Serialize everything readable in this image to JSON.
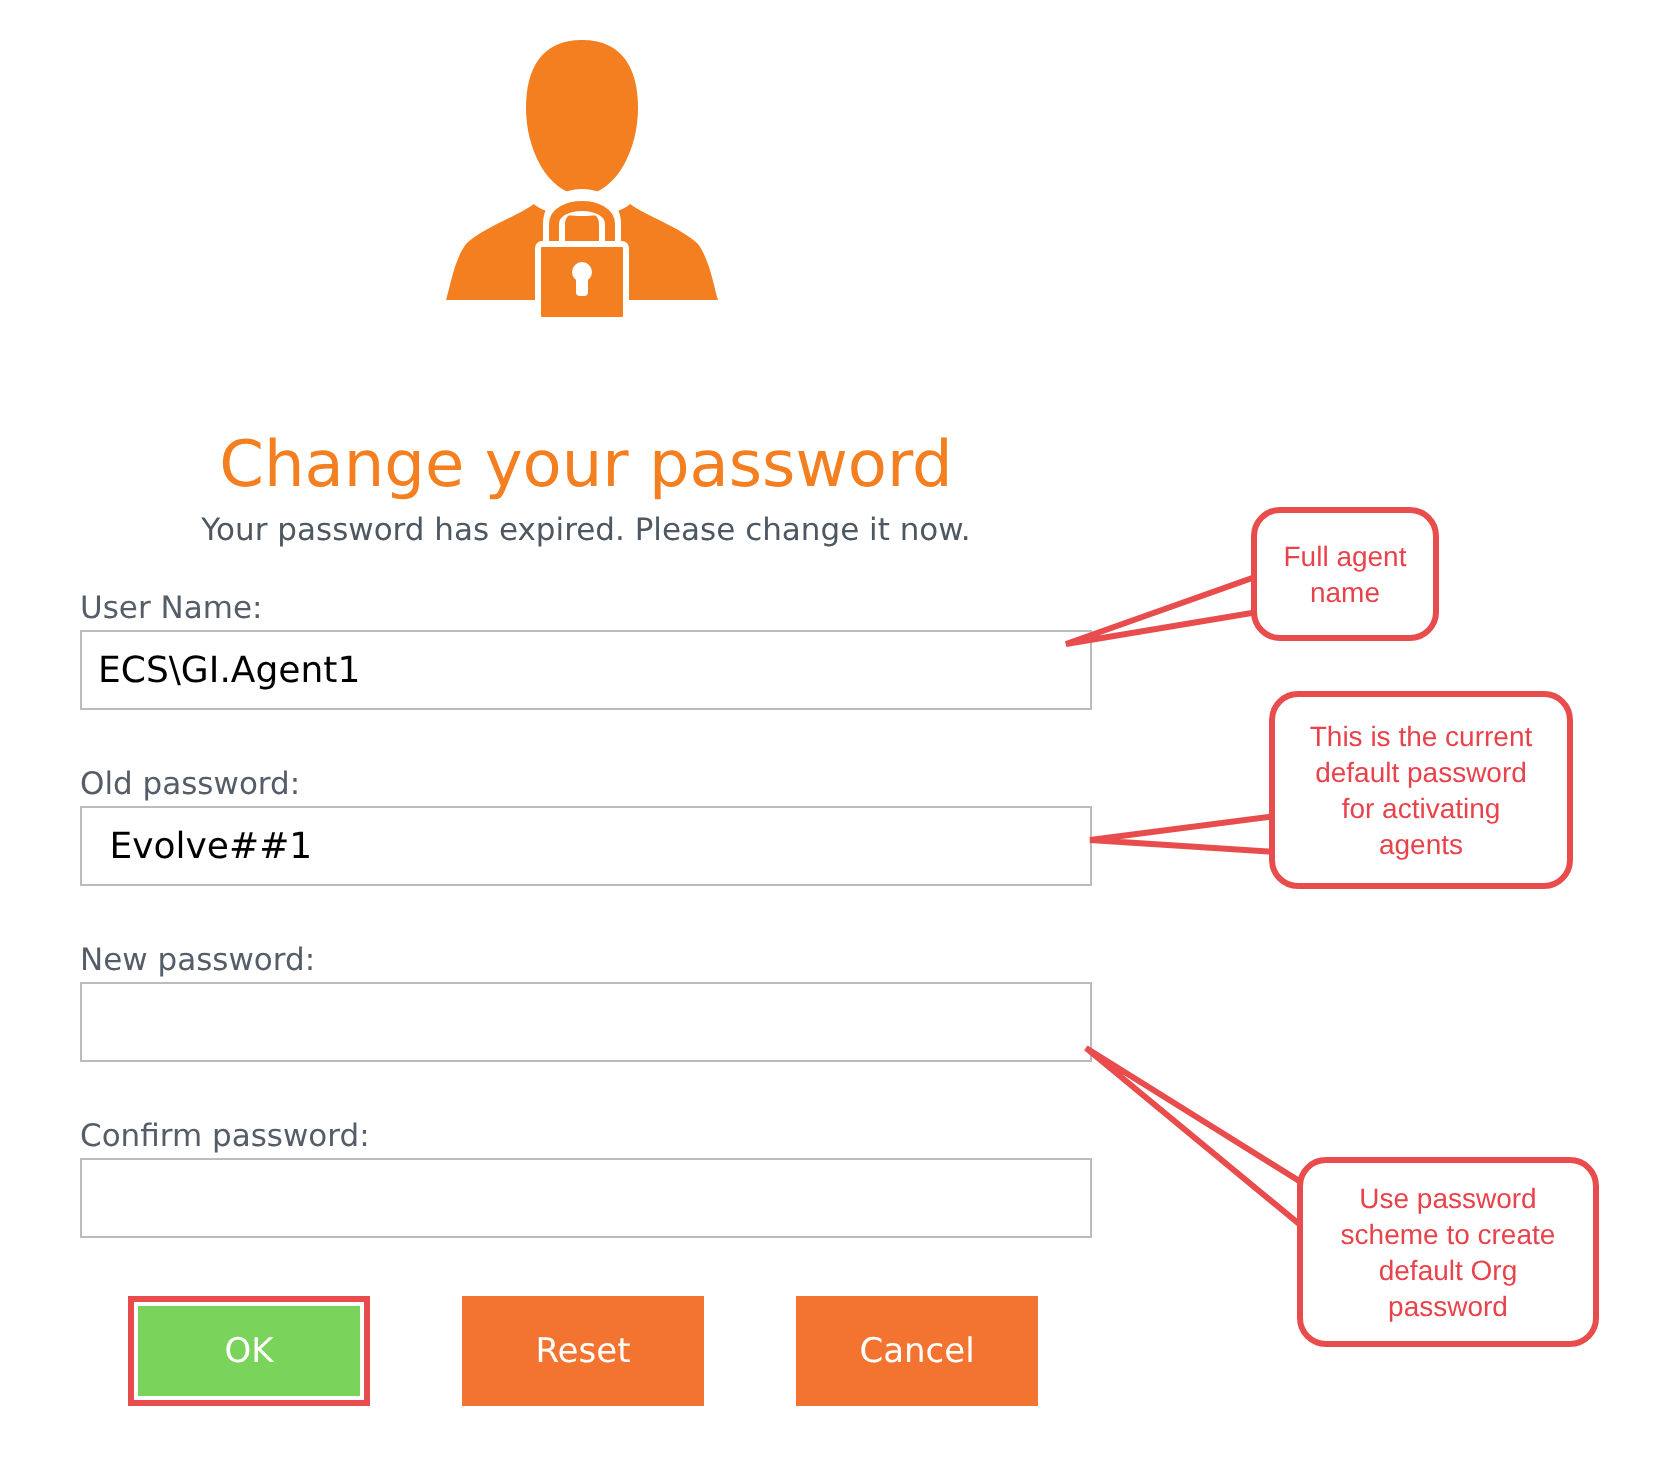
{
  "title": "Change your password",
  "subtitle": "Your password has expired. Please change it now.",
  "fields": [
    {
      "label": "User Name:",
      "value": "ECS\\GI.Agent1"
    },
    {
      "label": "Old password:",
      "value": " Evolve##1"
    },
    {
      "label": "New password:"
    },
    {
      "label": "Confirm password:"
    }
  ],
  "buttons": [
    {
      "label": "OK",
      "kind": "primary",
      "highlighted": true
    },
    {
      "label": "Reset",
      "kind": "secondary",
      "highlighted": false
    },
    {
      "label": "Cancel",
      "kind": "secondary",
      "highlighted": false
    }
  ],
  "callouts": [
    {
      "text": "Full agent name"
    },
    {
      "text": "This is the current default password for activating agents"
    },
    {
      "text": "Use password scheme to create default Org password"
    }
  ]
}
